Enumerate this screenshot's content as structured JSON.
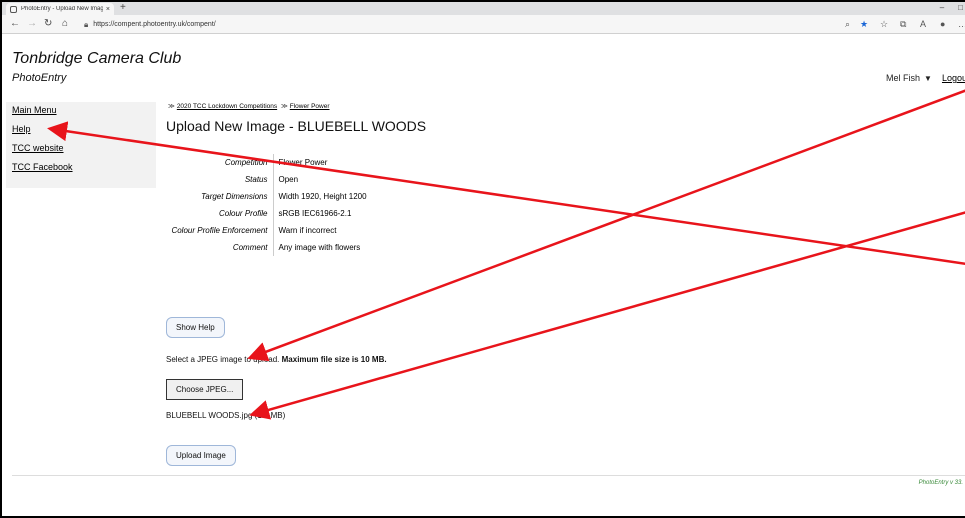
{
  "browser": {
    "tab_title": "PhotoEntry - Upload New Image",
    "tab_close": "×",
    "new_tab": "+",
    "url": "https://compent.photoentry.uk/compent/",
    "window_controls": [
      "–",
      "□"
    ]
  },
  "header": {
    "club_name": "Tonbridge Camera Club",
    "app_name": "PhotoEntry",
    "user_name": "Mel Fish",
    "user_caret": "▼",
    "logout": "Logou"
  },
  "sidebar": {
    "items": [
      {
        "label": "Main Menu"
      },
      {
        "label": "Help"
      },
      {
        "label": "TCC website"
      },
      {
        "label": "TCC Facebook"
      }
    ]
  },
  "breadcrumb": {
    "separator": "≫",
    "items": [
      {
        "label": "2020 TCC Lockdown Competitions"
      },
      {
        "label": "Flower Power"
      }
    ]
  },
  "main": {
    "heading": "Upload New Image - BLUEBELL WOODS",
    "details": [
      {
        "label": "Competition",
        "value": "Flower Power"
      },
      {
        "label": "Status",
        "value": "Open"
      },
      {
        "label": "Target Dimensions",
        "value": "Width 1920, Height 1200"
      },
      {
        "label": "Colour Profile",
        "value": "sRGB IEC61966-2.1"
      },
      {
        "label": "Colour Profile Enforcement",
        "value": "Warn if incorrect"
      },
      {
        "label": "Comment",
        "value": "Any image with flowers"
      }
    ],
    "show_help_label": "Show Help",
    "instruction_text": "Select a JPEG image to upload.",
    "instruction_bold": "Maximum file size is 10 MB.",
    "choose_label": "Choose JPEG...",
    "file_info": "BLUEBELL WOODS.jpg (1.5 MB)",
    "upload_label": "Upload Image"
  },
  "footer": {
    "version": "PhotoEntry v 33."
  },
  "colors": {
    "annotation": "#e8141b",
    "footer_version": "#3a8a3a",
    "button_border": "#9fb7d9"
  }
}
